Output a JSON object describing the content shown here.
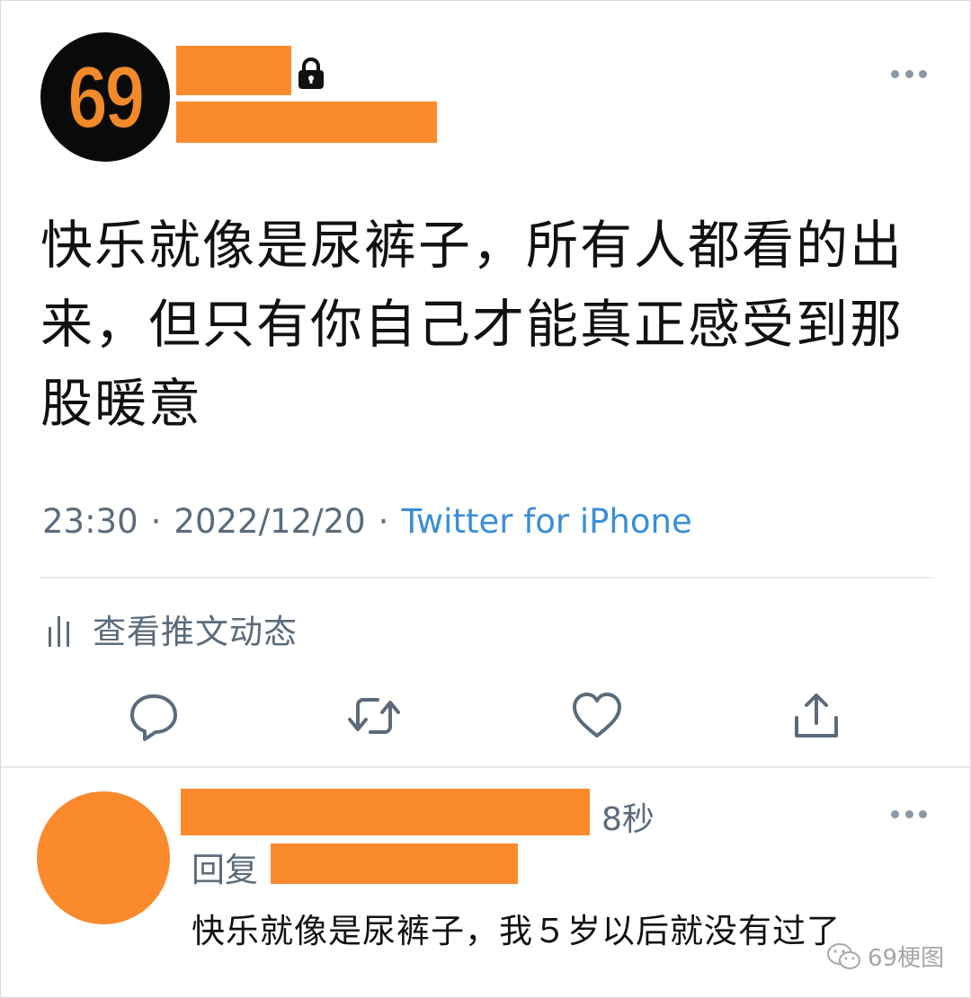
{
  "tweet": {
    "avatar_text": "69",
    "text": "快乐就像是尿裤子，所有人都看的出来，但只有你自己才能真正感受到那股暖意",
    "time": "23:30",
    "date": "2022/12/20",
    "separator": "·",
    "source": "Twitter for iPhone",
    "activity_label": "查看推文动态"
  },
  "icons": {
    "lock": "lock-icon",
    "more": "more-options-icon",
    "activity": "analytics-icon",
    "reply": "reply-icon",
    "retweet": "retweet-icon",
    "like": "heart-icon",
    "share": "share-icon",
    "watermark": "wechat-icon"
  },
  "reply": {
    "time": "8秒",
    "reply_prefix": "回复",
    "text": "快乐就像是尿裤子，我５岁以后就没有过了"
  },
  "watermark": {
    "text": "69梗图"
  },
  "colors": {
    "redaction": "#fb8a2d",
    "link": "#3a8fd6",
    "secondary_text": "#5b6b7b",
    "icon_gray": "#5b6b7b"
  }
}
